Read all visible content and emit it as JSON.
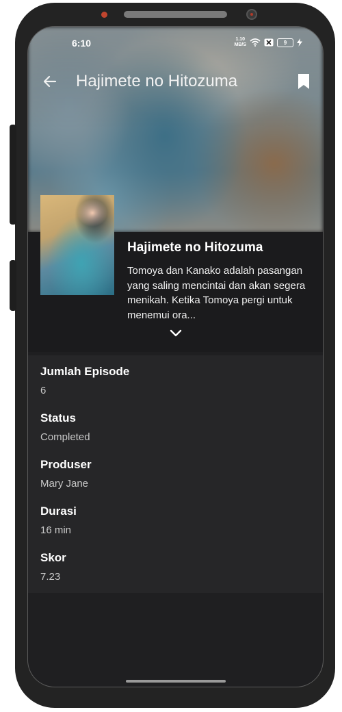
{
  "status_bar": {
    "time": "6:10",
    "net_speed_value": "1.10",
    "net_speed_unit": "MB/S",
    "battery": "9"
  },
  "app_bar": {
    "back_icon": "arrow-left-icon",
    "title": "Hajimete no Hitozuma",
    "bookmark_icon": "bookmark-icon"
  },
  "anime": {
    "title": "Hajimete no Hitozuma",
    "synopsis": "Tomoya dan Kanako adalah pasangan yang saling mencintai dan akan segera menikah. Ketika Tomoya pergi untuk menemui ora...",
    "expand_icon": "chevron-down-icon"
  },
  "details": [
    {
      "label": "Jumlah Episode",
      "value": "6"
    },
    {
      "label": "Status",
      "value": "Completed"
    },
    {
      "label": "Produser",
      "value": "Mary Jane"
    },
    {
      "label": "Durasi",
      "value": "16 min"
    },
    {
      "label": "Skor",
      "value": "7.23"
    }
  ],
  "colors": {
    "background": "#1f1f21",
    "details_bg": "#262628",
    "text": "#ffffff"
  }
}
